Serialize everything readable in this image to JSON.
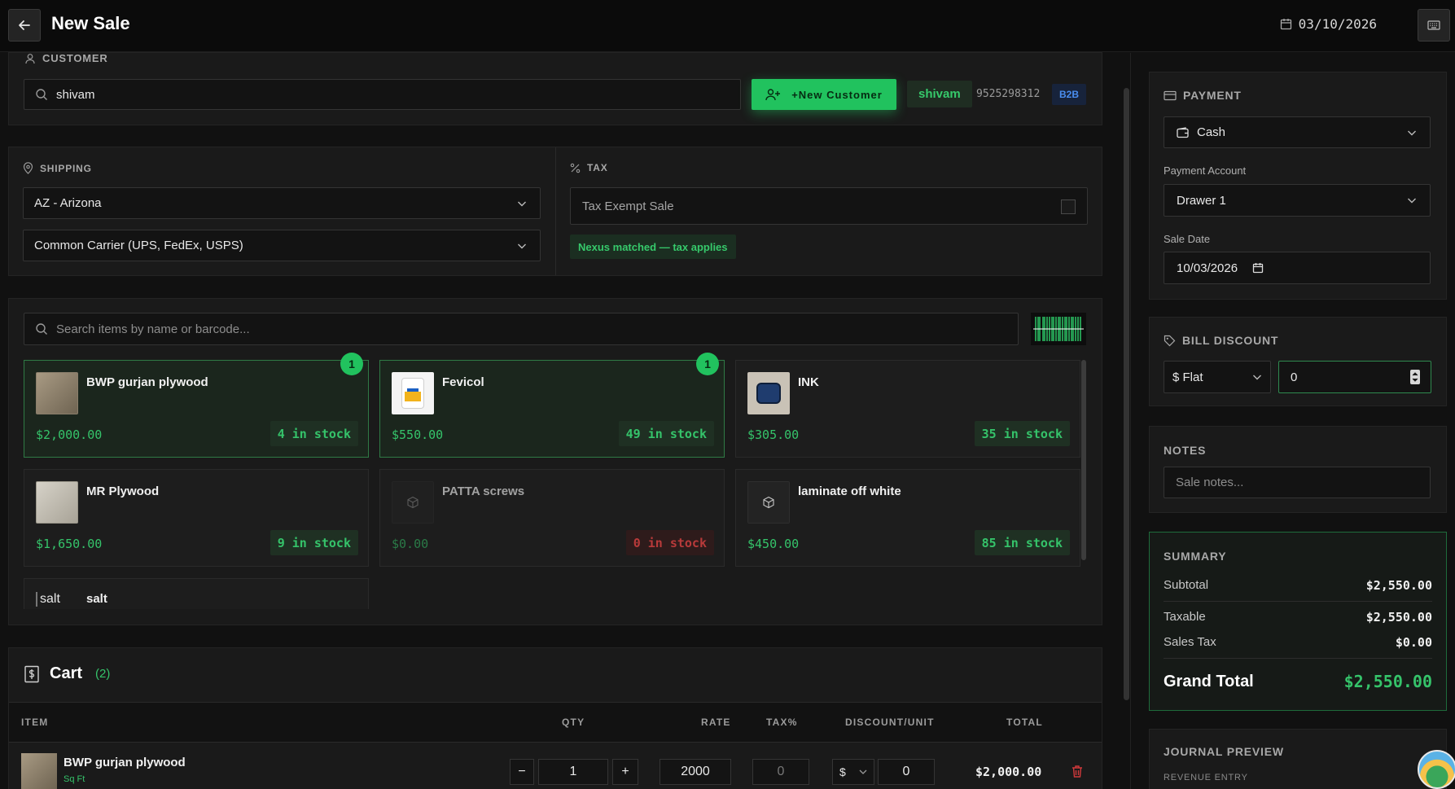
{
  "header": {
    "title": "New Sale",
    "date": "03/10/2026"
  },
  "customer": {
    "section_label": "CUSTOMER",
    "search_value": "shivam",
    "new_customer_label": "+New Customer",
    "selected_name": "shivam",
    "selected_phone": "9525298312",
    "selected_type": "B2B"
  },
  "shipping": {
    "section_label": "SHIPPING",
    "state": "AZ - Arizona",
    "carrier": "Common Carrier (UPS, FedEx, USPS)"
  },
  "tax": {
    "section_label": "TAX",
    "exempt_label": "Tax Exempt Sale",
    "exempt_checked": false,
    "nexus_note": "Nexus matched — tax applies"
  },
  "items": {
    "search_placeholder": "Search items by name or barcode...",
    "list": [
      {
        "name": "BWP gurjan plywood",
        "price": "$2,000.00",
        "stock": "4 in stock",
        "selected": true,
        "qty": "1"
      },
      {
        "name": "Fevicol",
        "price": "$550.00",
        "stock": "49 in stock",
        "selected": true,
        "qty": "1"
      },
      {
        "name": "INK",
        "price": "$305.00",
        "stock": "35 in stock",
        "selected": false
      },
      {
        "name": "MR Plywood",
        "price": "$1,650.00",
        "stock": "9 in stock",
        "selected": false
      },
      {
        "name": "PATTA screws",
        "price": "$0.00",
        "stock": "0 in stock",
        "selected": false,
        "out": true
      },
      {
        "name": "laminate off white",
        "price": "$450.00",
        "stock": "85 in stock",
        "selected": false
      },
      {
        "name": "salt",
        "img_alt": "salt"
      }
    ]
  },
  "cart": {
    "title": "Cart",
    "count": "(2)",
    "columns": {
      "item": "ITEM",
      "qty": "QTY",
      "rate": "RATE",
      "tax": "TAX%",
      "discount": "DISCOUNT/UNIT",
      "total": "TOTAL"
    },
    "rows": [
      {
        "name": "BWP gurjan plywood",
        "unit": "Sq Ft",
        "qty": "1",
        "rate": "2000",
        "tax": "0",
        "discount_type": "$",
        "discount": "0",
        "total": "$2,000.00"
      }
    ]
  },
  "payment": {
    "section_label": "PAYMENT",
    "method": "Cash",
    "account_label": "Payment Account",
    "account": "Drawer 1",
    "sale_date_label": "Sale Date",
    "sale_date": "10/03/2026"
  },
  "bill_discount": {
    "section_label": "BILL DISCOUNT",
    "type": "$ Flat",
    "value": "0"
  },
  "notes": {
    "section_label": "NOTES",
    "placeholder": "Sale notes..."
  },
  "summary": {
    "section_label": "SUMMARY",
    "subtotal_label": "Subtotal",
    "subtotal": "$2,550.00",
    "taxable_label": "Taxable",
    "taxable": "$2,550.00",
    "sales_tax_label": "Sales Tax",
    "sales_tax": "$0.00",
    "grand_total_label": "Grand Total",
    "grand_total": "$2,550.00"
  },
  "journal": {
    "section_label": "JOURNAL PREVIEW",
    "sub_label": "REVENUE ENTRY"
  },
  "colors": {
    "accent": "#21c25e",
    "background": "#111111",
    "panel": "#1a1a1a",
    "danger": "#d0393b",
    "b2b": "#4a8ef0"
  }
}
